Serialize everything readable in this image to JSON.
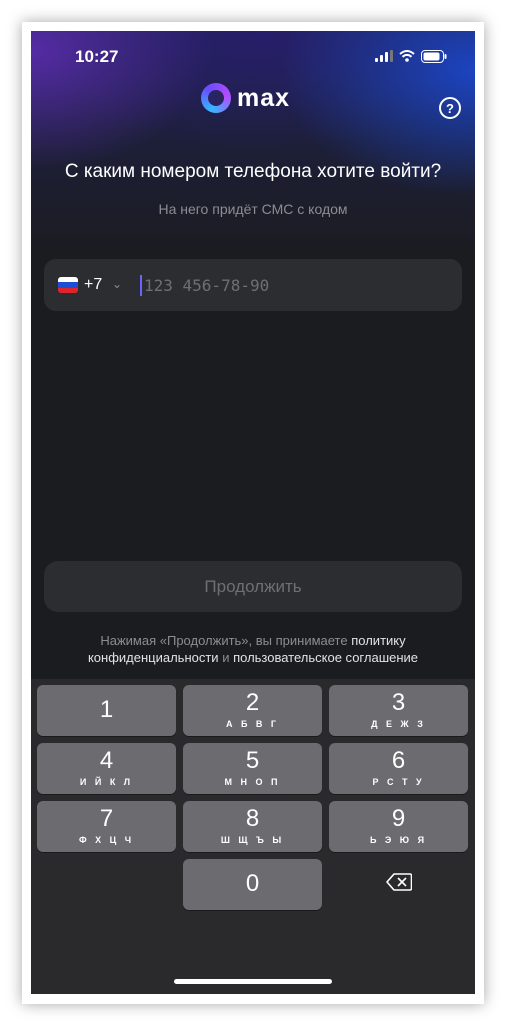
{
  "status_bar": {
    "time": "10:27"
  },
  "logo": {
    "text": "max"
  },
  "help": {
    "icon": "question-icon",
    "label": "?"
  },
  "login": {
    "title": "С каким номером телефона хотите войти?",
    "subtitle": "На него придёт СМС с кодом",
    "country_code": "+7",
    "phone_placeholder": "123 456-78-90",
    "continue_label": "Продолжить",
    "terms_prefix": "Нажимая «Продолжить», вы принимаете",
    "terms_policy_a": "политику",
    "terms_policy_b": "конфиденциальности",
    "terms_and": "и",
    "terms_agreement": "пользовательское соглашение"
  },
  "colors": {
    "accent": "#6b63ff",
    "field_bg": "#2c2d31",
    "muted": "#8c8d92"
  },
  "keyboard": {
    "keys": [
      {
        "num": "1",
        "letters": ""
      },
      {
        "num": "2",
        "letters": "А Б В Г"
      },
      {
        "num": "3",
        "letters": "Д Е Ж З"
      },
      {
        "num": "4",
        "letters": "И Й К Л"
      },
      {
        "num": "5",
        "letters": "М Н О П"
      },
      {
        "num": "6",
        "letters": "Р С Т У"
      },
      {
        "num": "7",
        "letters": "Ф Х Ц Ч"
      },
      {
        "num": "8",
        "letters": "Ш Щ Ъ Ы"
      },
      {
        "num": "9",
        "letters": "Ь Э Ю Я"
      },
      {
        "num": "0",
        "letters": ""
      }
    ]
  }
}
